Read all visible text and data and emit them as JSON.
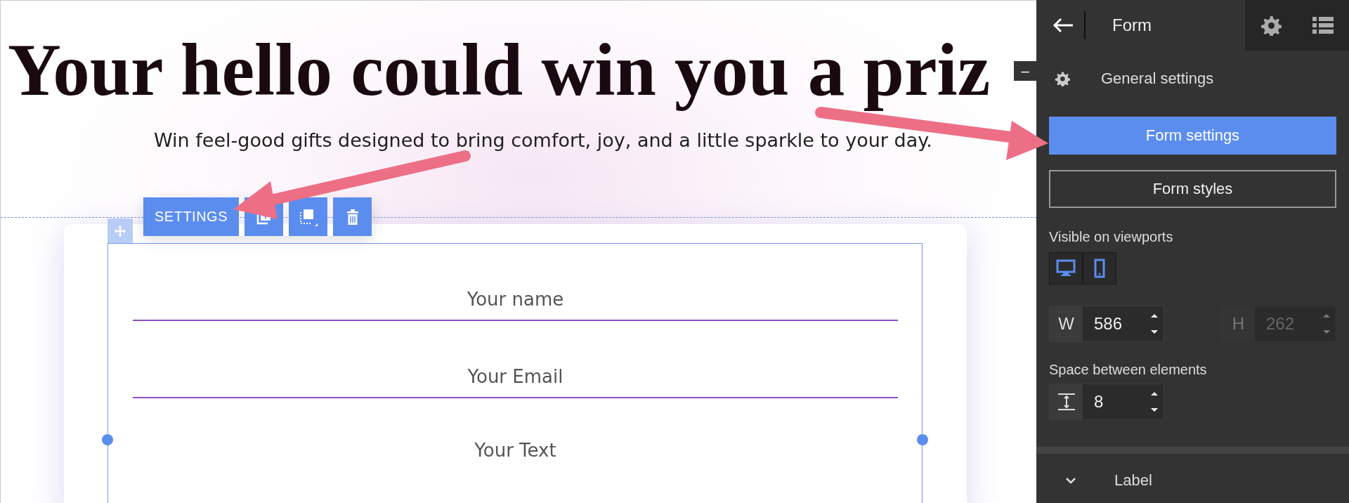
{
  "canvas": {
    "heading": "Your hello could win you a priz",
    "subtitle": "Win feel-good gifts designed to bring comfort, joy, and a little sparkle to your day.",
    "collapse_label": "–",
    "toolbar": {
      "settings_label": "SETTINGS"
    },
    "form_fields": [
      {
        "kind": "input",
        "placeholder": "Your name"
      },
      {
        "kind": "input",
        "placeholder": "Your Email"
      },
      {
        "kind": "textarea",
        "placeholder": "Your Text"
      }
    ]
  },
  "panel": {
    "title": "Form",
    "general_settings": "General settings",
    "tabs": [
      {
        "label": "Form settings",
        "selected": true
      },
      {
        "label": "Form styles",
        "selected": false
      }
    ],
    "viewports": {
      "label": "Visible on viewports",
      "devices": [
        {
          "kind": "desktop",
          "on": true
        },
        {
          "kind": "mobile",
          "on": true
        }
      ]
    },
    "size_fields": [
      {
        "label": "W",
        "value": "586",
        "disabled": false
      },
      {
        "label": "H",
        "value": "262",
        "disabled": true
      }
    ],
    "spacing": {
      "label": "Space between elements",
      "value": "8"
    },
    "sections": [
      {
        "label": "Label",
        "expanded": false
      }
    ]
  }
}
